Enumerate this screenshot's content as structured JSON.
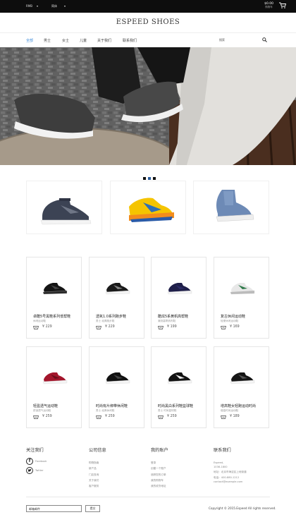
{
  "topbar": {
    "currency": "RMB",
    "language": "简体",
    "cart_total": "$0.00",
    "cart_sub": "购物车"
  },
  "logo": "ESPEED SHOES",
  "nav": {
    "items": [
      {
        "label": "全部",
        "active": true
      },
      {
        "label": "男士",
        "active": false
      },
      {
        "label": "女士",
        "active": false
      },
      {
        "label": "儿童",
        "active": false
      },
      {
        "label": "关于我们",
        "active": false
      },
      {
        "label": "联系我们",
        "active": false
      }
    ],
    "search_placeholder": "搜索"
  },
  "slider": {
    "dots": 3,
    "active_dot": 1
  },
  "featured": [
    "navy-boot",
    "kids-yellow-sneaker",
    "blue-highcut"
  ],
  "products": [
    {
      "name": "卓酷5号黑鞋系列低帮鞋",
      "sub": "休闲运动鞋",
      "price": "229"
    },
    {
      "name": "透氧1.0系列跑步鞋",
      "sub": "男士 经典跑步鞋",
      "price": "229"
    },
    {
      "name": "酷炫5系黄帆高帮鞋",
      "sub": "潮流高帮帆布鞋",
      "price": "199"
    },
    {
      "name": "复古休闲运动鞋",
      "sub": "轻便休闲运动鞋",
      "price": "169"
    },
    {
      "name": "轻盈透气运动鞋",
      "sub": "舒适透气运动鞋",
      "price": "259"
    },
    {
      "name": "时尚有片绑带休闲鞋",
      "sub": "男士 经典休闲鞋",
      "price": "259"
    },
    {
      "name": "时尚黑白系列鞋篮球鞋",
      "sub": "男士 时尚篮球鞋",
      "price": "259"
    },
    {
      "name": "增高鞋女轻跑运动时尚",
      "sub": "增高时尚运动鞋",
      "price": "189"
    }
  ],
  "footer": {
    "follow": {
      "title": "关注我们",
      "facebook": "Facebook",
      "twitter": "Twitter"
    },
    "company": {
      "title": "公司信息",
      "links": [
        "购物指南",
        "新产品",
        "门店查询",
        "关于我们",
        "客户服务"
      ]
    },
    "account": {
      "title": "我的账户",
      "links": [
        "登录",
        "创建一个账户",
        "追踪您的订单",
        "我的购物车",
        "我的收货地址"
      ]
    },
    "contact": {
      "title": "联系我们",
      "lines": [
        "Espeed,",
        "1036-1800",
        "地址：北京市海淀区上地街道",
        "电话：400-880-1212",
        "contact@example.com"
      ]
    },
    "email_placeholder": "邮箱邮件",
    "subscribe": "提交",
    "copyright": "Copyright © 2015.Espeed All rights reserved."
  },
  "colors": {
    "active_nav": "#3d8bd9",
    "topbar": "#0d0d0d"
  }
}
